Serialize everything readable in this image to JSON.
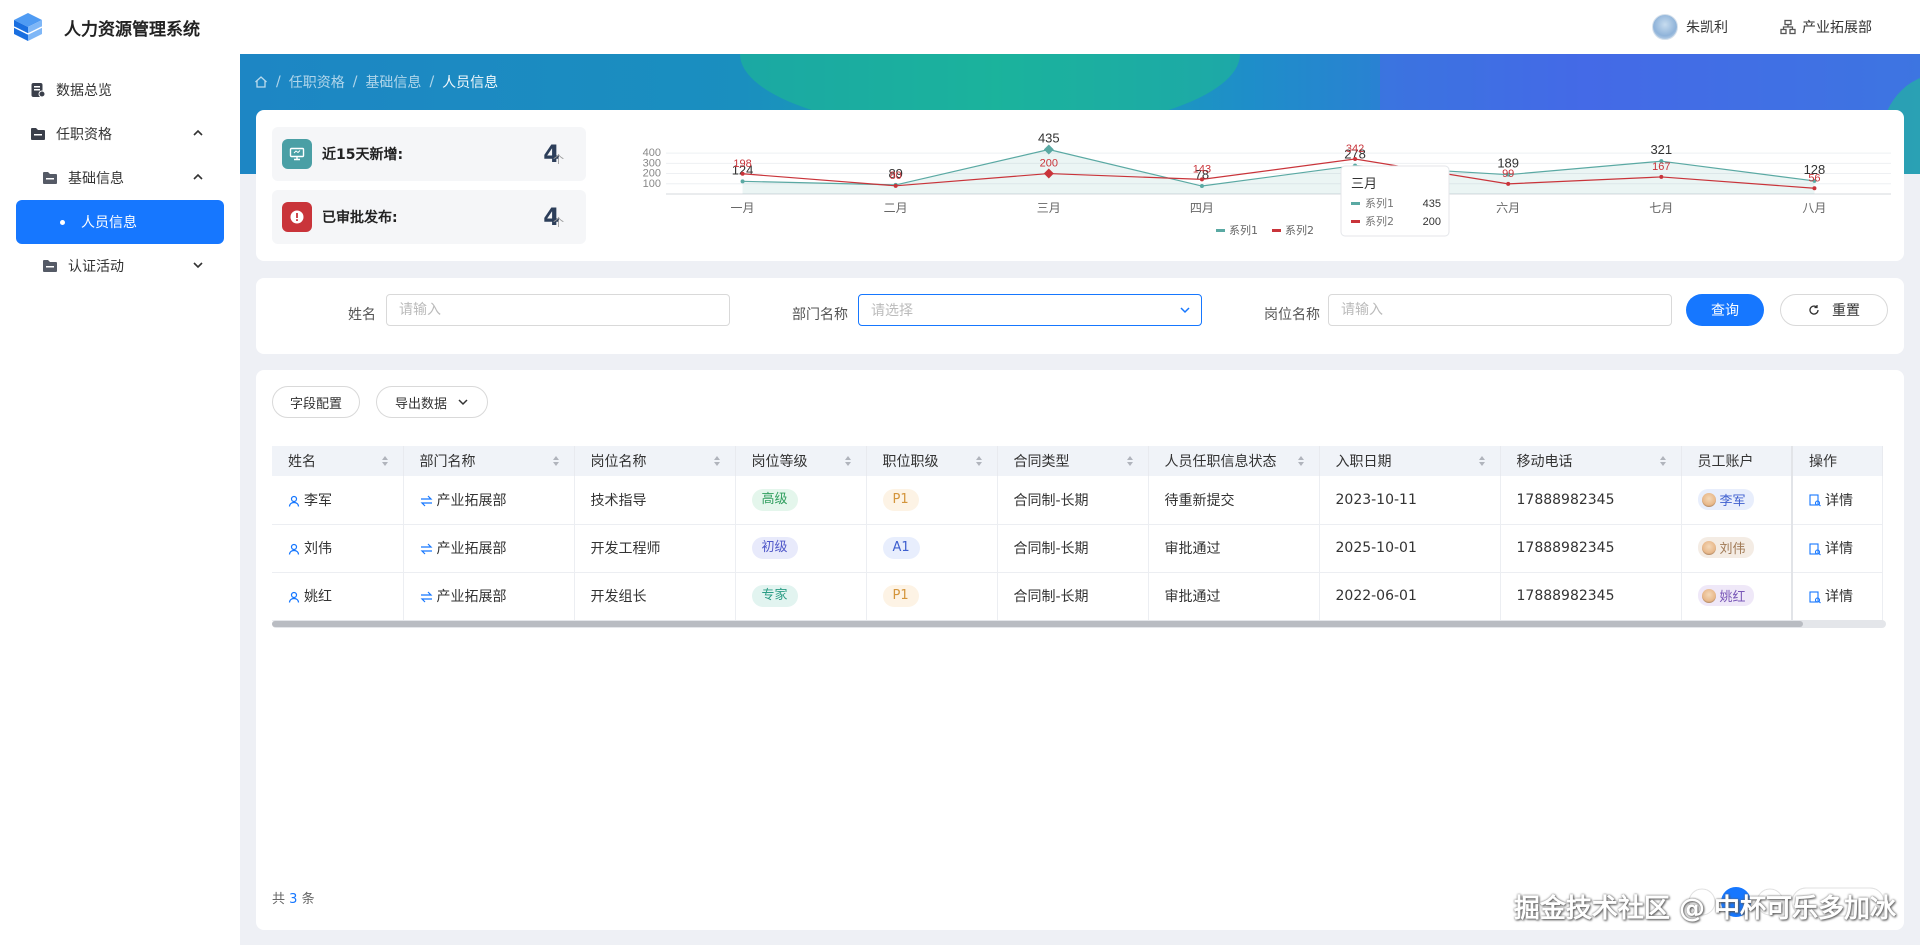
{
  "header": {
    "title": "人力资源管理系统",
    "user_name": "朱凯利",
    "department": "产业拓展部"
  },
  "sidebar": {
    "items": [
      {
        "label": "数据总览"
      },
      {
        "label": "任职资格"
      },
      {
        "label": "基础信息"
      },
      {
        "label": "人员信息"
      },
      {
        "label": "认证活动"
      }
    ]
  },
  "breadcrumb": {
    "items": [
      "任职资格",
      "基础信息",
      "人员信息"
    ]
  },
  "stats": {
    "new_label": "近15天新增:",
    "new_value": "4",
    "new_unit": "个",
    "approved_label": "已审批发布:",
    "approved_value": "4",
    "approved_unit": "个"
  },
  "chart_data": {
    "type": "line",
    "categories": [
      "一月",
      "二月",
      "三月",
      "四月",
      "五月",
      "六月",
      "七月",
      "八月"
    ],
    "series": [
      {
        "name": "系列1",
        "values": [
          124,
          89,
          435,
          78,
          278,
          189,
          321,
          128
        ],
        "color": "#5aa9a3"
      },
      {
        "name": "系列2",
        "values": [
          198,
          80,
          200,
          143,
          342,
          99,
          167,
          56
        ],
        "color": "#c9343a"
      }
    ],
    "y_ticks": [
      "400",
      "300",
      "200",
      "100"
    ],
    "ylim": [
      0,
      450
    ],
    "legend_position": "bottom",
    "tooltip": {
      "title": "三月",
      "rows": [
        {
          "name": "系列1",
          "value": "435"
        },
        {
          "name": "系列2",
          "value": "200"
        }
      ]
    }
  },
  "search": {
    "name_label": "姓名",
    "name_placeholder": "请输入",
    "dept_label": "部门名称",
    "dept_placeholder": "请选择",
    "post_label": "岗位名称",
    "post_placeholder": "请输入",
    "query_label": "查询",
    "reset_label": "重置"
  },
  "toolbar": {
    "field_config": "字段配置",
    "export": "导出数据"
  },
  "table": {
    "columns": [
      "姓名",
      "部门名称",
      "岗位名称",
      "岗位等级",
      "职位职级",
      "合同类型",
      "人员任职信息状态",
      "入职日期",
      "移动电话",
      "员工账户",
      "操作"
    ],
    "rows": [
      {
        "name": "李军",
        "dept": "产业拓展部",
        "post": "技术指导",
        "level": "高级",
        "rank": "P1",
        "contract": "合同制-长期",
        "status": "待重新提交",
        "date": "2023-10-11",
        "phone": "17888982345",
        "account": "李军",
        "action": "详情"
      },
      {
        "name": "刘伟",
        "dept": "产业拓展部",
        "post": "开发工程师",
        "level": "初级",
        "rank": "A1",
        "contract": "合同制-长期",
        "status": "审批通过",
        "date": "2025-10-01",
        "phone": "17888982345",
        "account": "刘伟",
        "action": "详情"
      },
      {
        "name": "姚红",
        "dept": "产业拓展部",
        "post": "开发组长",
        "level": "专家",
        "rank": "P1",
        "contract": "合同制-长期",
        "status": "审批通过",
        "date": "2022-06-01",
        "phone": "17888982345",
        "account": "姚红",
        "action": "详情"
      }
    ]
  },
  "pagination": {
    "total_prefix": "共",
    "total": "3",
    "total_suffix": "条",
    "current_page": "1"
  },
  "watermark": "掘金技术社区 @ 中杯可乐多加冰"
}
